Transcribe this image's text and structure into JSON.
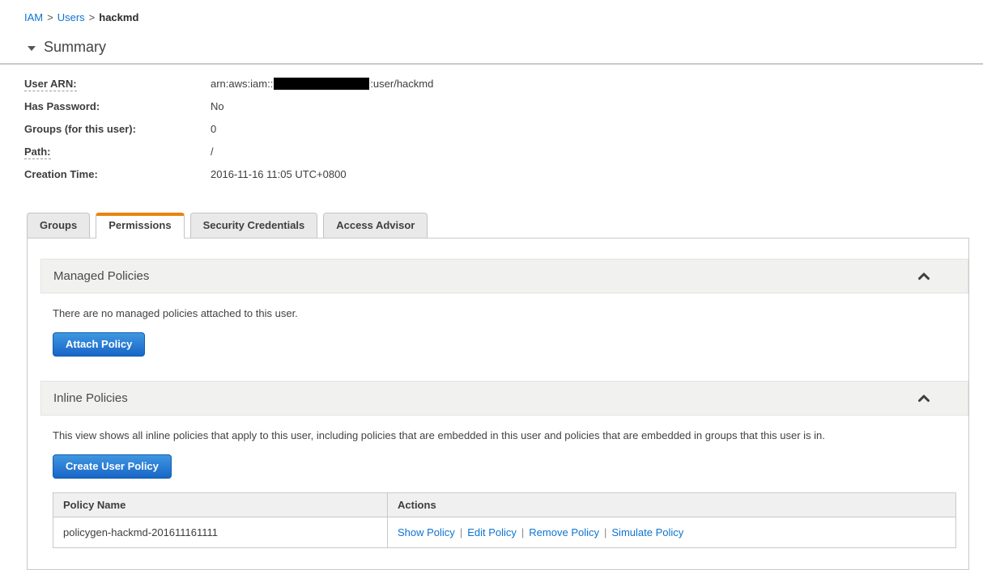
{
  "breadcrumb": {
    "separator": ">",
    "items": [
      {
        "label": "IAM"
      },
      {
        "label": "Users"
      },
      {
        "label": "hackmd"
      }
    ]
  },
  "summary": {
    "title": "Summary",
    "fields": [
      {
        "label": "User ARN:",
        "value_prefix": "arn:aws:iam::",
        "redacted": "account-id",
        "value_suffix": ":user/hackmd"
      },
      {
        "label": "Has Password:",
        "value": "No"
      },
      {
        "label": "Groups (for this user):",
        "value": "0"
      },
      {
        "label": "Path:",
        "value": "/"
      },
      {
        "label": "Creation Time:",
        "value": "2016-11-16 11:05 UTC+0800"
      }
    ]
  },
  "tabs": [
    {
      "label": "Groups",
      "active": false
    },
    {
      "label": "Permissions",
      "active": true
    },
    {
      "label": "Security Credentials",
      "active": false
    },
    {
      "label": "Access Advisor",
      "active": false
    }
  ],
  "managed_policies": {
    "title": "Managed Policies",
    "empty_text": "There are no managed policies attached to this user.",
    "attach_button": "Attach Policy",
    "collapse_icon": "chevron-up-icon"
  },
  "inline_policies": {
    "title": "Inline Policies",
    "description": "This view shows all inline policies that apply to this user, including policies that are embedded in this user and policies that are embedded in groups that this user is in.",
    "create_button": "Create User Policy",
    "collapse_icon": "chevron-up-icon",
    "table": {
      "headers": [
        "Policy Name",
        "Actions"
      ],
      "actions_separator": "|",
      "rows": [
        {
          "policy_name": "policygen-hackmd-201611161111",
          "actions": [
            "Show Policy",
            "Edit Policy",
            "Remove Policy",
            "Simulate Policy"
          ]
        }
      ]
    }
  },
  "colors": {
    "accent_orange": "#e8830c",
    "link_blue": "#0d74d1",
    "button_blue_top": "#3f97e0",
    "button_blue_bottom": "#1865c8",
    "section_header_bg": "#f1f1f0"
  }
}
